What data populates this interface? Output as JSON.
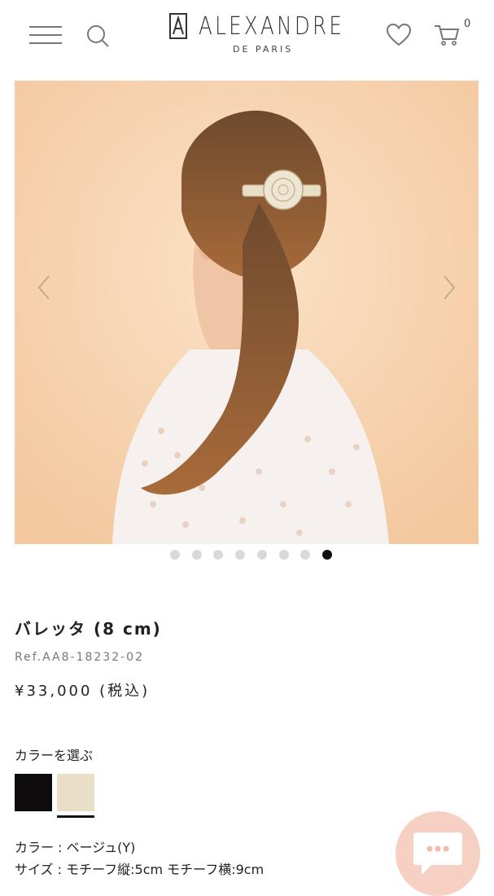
{
  "header": {
    "brand": "ALEXANDRE",
    "brand_sub": "DE PARIS",
    "cart_count": "0",
    "icons": [
      "menu-icon",
      "search-icon",
      "heart-icon",
      "cart-icon"
    ]
  },
  "carousel": {
    "total_slides": 8,
    "active_index": 7,
    "background_color": "#f8d7b5"
  },
  "product": {
    "title": "バレッタ (8 cm)",
    "ref": "Ref.AA8-18232-02",
    "price": "¥33,000 (税込)"
  },
  "color_picker": {
    "heading": "カラーを選ぶ",
    "swatches": [
      {
        "name": "black",
        "color": "#0d0b0b"
      },
      {
        "name": "beige",
        "color": "#e9dfc6",
        "selected": true
      }
    ]
  },
  "specs": {
    "color": "カラー : ベージュ(Y)",
    "size": "サイズ : モチーフ縦:5cm モチーフ横:9cm"
  },
  "colors": {
    "accent_chat": "#f6cfc0",
    "dot_active": "#111111",
    "dot_inactive": "#d9d9d9"
  }
}
